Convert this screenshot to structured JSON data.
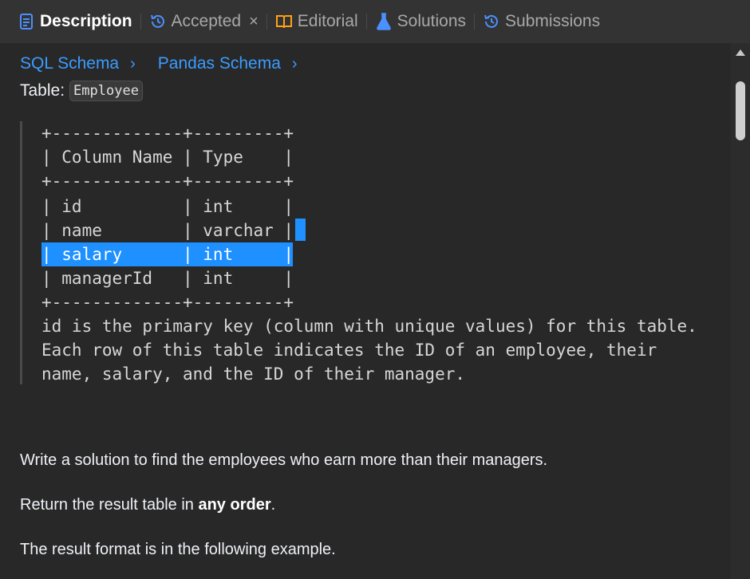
{
  "tabs": [
    {
      "label": "Description",
      "icon": "description-icon"
    },
    {
      "label": "Accepted",
      "icon": "clock-history-icon"
    },
    {
      "label": "Editorial",
      "icon": "book-icon"
    },
    {
      "label": "Solutions",
      "icon": "flask-icon"
    },
    {
      "label": "Submissions",
      "icon": "clock-history-icon"
    }
  ],
  "close_symbol": "×",
  "schema_links": [
    {
      "label": "SQL Schema"
    },
    {
      "label": "Pandas Schema"
    }
  ],
  "table_label": "Table:",
  "table_name": "Employee",
  "schema_lines": [
    "+-------------+---------+",
    "| Column Name | Type    |",
    "+-------------+---------+",
    "| id          | int     |",
    "| name        | varchar |",
    "| salary      | int     |",
    "| managerId   | int     |",
    "+-------------+---------+",
    "id is the primary key (column with unique values) for this table.",
    "Each row of this table indicates the ID of an employee, their",
    "name, salary, and the ID of their manager."
  ],
  "problem": {
    "statement": "Write a solution to find the employees who earn more than their managers.",
    "order_prefix": "Return the result table in ",
    "order_bold": "any order",
    "order_suffix": ".",
    "format_note": "The result format is in the following example."
  },
  "colors": {
    "accent": "#3b9cff",
    "selection": "#1e90ff",
    "background": "#282828",
    "tabbar": "#333333"
  }
}
